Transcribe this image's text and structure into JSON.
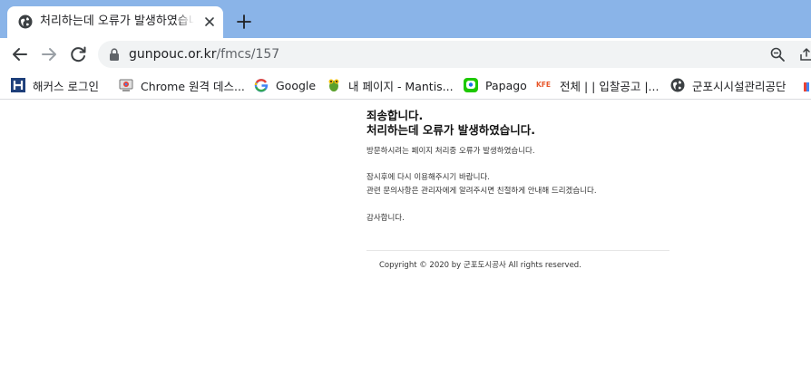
{
  "tab": {
    "title": "처리하는데 오류가 발생하였습니다",
    "favicon_icon": "globe-icon",
    "close_icon": "close-icon"
  },
  "toolbar": {
    "back_icon": "back-arrow-icon",
    "forward_icon": "forward-arrow-icon",
    "reload_icon": "reload-icon",
    "url_host": "gunpouc.or.kr",
    "url_path": "/fmcs/157",
    "zoom_icon": "zoom-icon",
    "share_icon": "share-icon"
  },
  "bookmarks": [
    {
      "label": "해커스 로그인",
      "icon": "hackers-h-icon"
    },
    {
      "label": "Chrome 원격 데스...",
      "icon": "chrome-remote-desktop-icon"
    },
    {
      "label": "Google",
      "icon": "google-g-icon"
    },
    {
      "label": "내 페이지 - Mantis...",
      "icon": "mantis-icon"
    },
    {
      "label": "Papago",
      "icon": "papago-icon"
    },
    {
      "label": "전체 | | 입찰공고 |...",
      "icon": "kfe-icon",
      "icon_text": "KFE"
    },
    {
      "label": "군포시시설관리공단",
      "icon": "globe-icon"
    }
  ],
  "page": {
    "heading_line1": "죄송합니다.",
    "heading_line2": "처리하는데 오류가 발생하였습니다.",
    "paragraph1": "방문하시려는 페이지 처리중 오류가 발생하였습니다.",
    "paragraph2_line1": "잠시후에 다시 이용해주시기 바랍니다.",
    "paragraph2_line2": "관련 문의사항은 관리자에게 알려주시면 친절하게 안내해 드리겠습니다.",
    "thanks": "감사합니다.",
    "copyright": "Copyright © 2020 by 군포도시공사 All rights reserved."
  },
  "colors": {
    "tabstrip": "#8ab4e8",
    "omnibox": "#f1f3f4"
  }
}
